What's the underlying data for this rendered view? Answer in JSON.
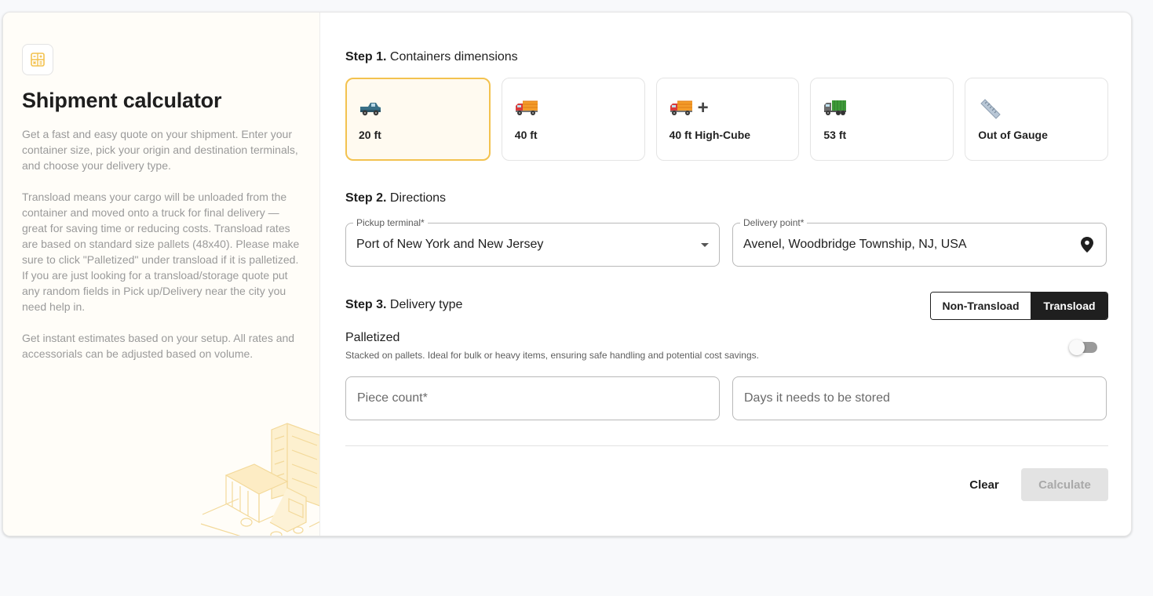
{
  "sidebar": {
    "icon": "calculator-icon",
    "title": "Shipment calculator",
    "paragraphs": [
      "Get a fast and easy quote on your shipment. Enter your container size, pick your origin and destination terminals, and choose your delivery type.",
      "Transload means your cargo will be unloaded from the container and moved onto a truck for final delivery — great for saving time or reducing costs. Transload rates are based on standard size pallets (48x40). Please make sure to click \"Palletized\" under transload if it is palletized. If you are just looking for a transload/storage quote put any random fields in Pick up/Delivery near the city you need help in.",
      "Get instant estimates based on your setup. All rates and accessorials can be adjusted based on volume."
    ]
  },
  "step1": {
    "label": "Step 1.",
    "title": "Containers dimensions",
    "options": [
      {
        "label": "20 ft",
        "icon": "pickup-truck-icon",
        "selected": true
      },
      {
        "label": "40 ft",
        "icon": "delivery-truck-icon",
        "selected": false
      },
      {
        "label": "40 ft High-Cube",
        "icon": "delivery-truck-plus-icon",
        "selected": false
      },
      {
        "label": "53 ft",
        "icon": "articulated-lorry-icon",
        "selected": false
      },
      {
        "label": "Out of Gauge",
        "icon": "ruler-icon",
        "selected": false
      }
    ]
  },
  "step2": {
    "label": "Step 2.",
    "title": "Directions",
    "pickup": {
      "label": "Pickup terminal*",
      "value": "Port of New York and New Jersey"
    },
    "delivery": {
      "label": "Delivery point*",
      "value": "Avenel, Woodbridge Township, NJ, USA"
    }
  },
  "step3": {
    "label": "Step 3.",
    "title": "Delivery type",
    "types": [
      "Non-Transload",
      "Transload"
    ],
    "selected_type": "Transload",
    "palletized": {
      "title": "Palletized",
      "description": "Stacked on pallets. Ideal for bulk or heavy items, ensuring safe handling and potential cost savings.",
      "enabled": false
    },
    "piece_count": {
      "placeholder": "Piece count*"
    },
    "days_stored": {
      "placeholder": "Days it needs to be stored"
    }
  },
  "actions": {
    "clear": "Clear",
    "calculate": "Calculate"
  },
  "colors": {
    "accent": "#f3c24f",
    "dark": "#1f1f1f",
    "disabled": "#e3e3e3"
  }
}
